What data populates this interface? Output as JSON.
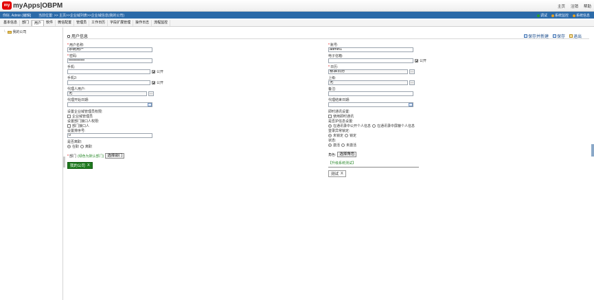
{
  "header": {
    "logo_mark": "my",
    "logo_text": "myApps|OBPM",
    "links": [
      "主页",
      "注销",
      "帮助"
    ]
  },
  "status": {
    "user": "你好, Admin [编辑]",
    "location": "当前位置: >> 主页>>企业域列表>>企业域信息(我的公司)",
    "right_items": [
      {
        "label": "调试",
        "icon": "debug-icon",
        "color": "#2aa02a"
      },
      {
        "label": "系统监控",
        "icon": "monitor-icon",
        "color": "#e8a020"
      },
      {
        "label": "系统信息",
        "icon": "info-icon",
        "color": "#e8a020"
      }
    ]
  },
  "menu": {
    "items": [
      "基本信息",
      "部门",
      "用户",
      "软件",
      "微信配置",
      "管理员",
      "工作日历",
      "字段扩展管理",
      "操作日志",
      "流程监控"
    ],
    "active_index": 2
  },
  "tree": {
    "root_label": "我的公司"
  },
  "panel": {
    "title": "用户信息",
    "actions": [
      {
        "label": "保存并新建",
        "icon": "save-new-icon"
      },
      {
        "label": "保存",
        "icon": "save-icon"
      },
      {
        "label": "退出",
        "icon": "exit-icon"
      }
    ]
  },
  "left": {
    "name_label": "用户名称:",
    "name_value": "系统用户",
    "password_label": "密码:",
    "password_value": "••••••••••••",
    "mobile_label": "手机:",
    "mobile_public": "公开",
    "mobile2_label": "手机2:",
    "mobile2_public": "公开",
    "proxy_label": "代理人用户:",
    "proxy_value": "无",
    "proxy_start_label": "代理开始日期:",
    "domain_admin_label": "设置企业域管理员权限:",
    "domain_admin_option": "企业域管理员",
    "dept_admin_label": "设置部门接口人权限:",
    "dept_admin_option": "部门接口人",
    "order_label": "设置排序号:",
    "order_value": "0",
    "onjob_label": "是否离职:",
    "onjob_options": [
      "在职",
      "离职"
    ],
    "dept_label": "部门",
    "dept_hint": "(绿色为默认部门)",
    "dept_button": "选择部门",
    "dept_tag": "我的公司",
    "dept_tag_x": "X"
  },
  "right": {
    "account_label": "账号:",
    "account_value": "admin1",
    "email_label": "电子信箱:",
    "email_public": "公开",
    "calendar_label": "日历:",
    "calendar_value": "标准日历",
    "superior_label": "上级:",
    "superior_value": "无",
    "remark_label": "备注:",
    "proxy_end_label": "代理结束日期:",
    "im_label": "即时通讯设置:",
    "im_option": "使用即时通讯",
    "privacy_label": "是否护信息设置:",
    "privacy_options": [
      "在通讯录中公开个人信息",
      "在通讯录中屏蔽个人信息"
    ],
    "device_label": "登录异常锁定:",
    "device_options": [
      "未锁定",
      "锁定"
    ],
    "state_label": "状态:",
    "state_options": [
      "激活",
      "未激活"
    ],
    "role_label": "角色:",
    "role_button": "选择角色",
    "role_group": "【升级系统测试】",
    "role_tag": "测试",
    "role_tag_x": "X"
  }
}
